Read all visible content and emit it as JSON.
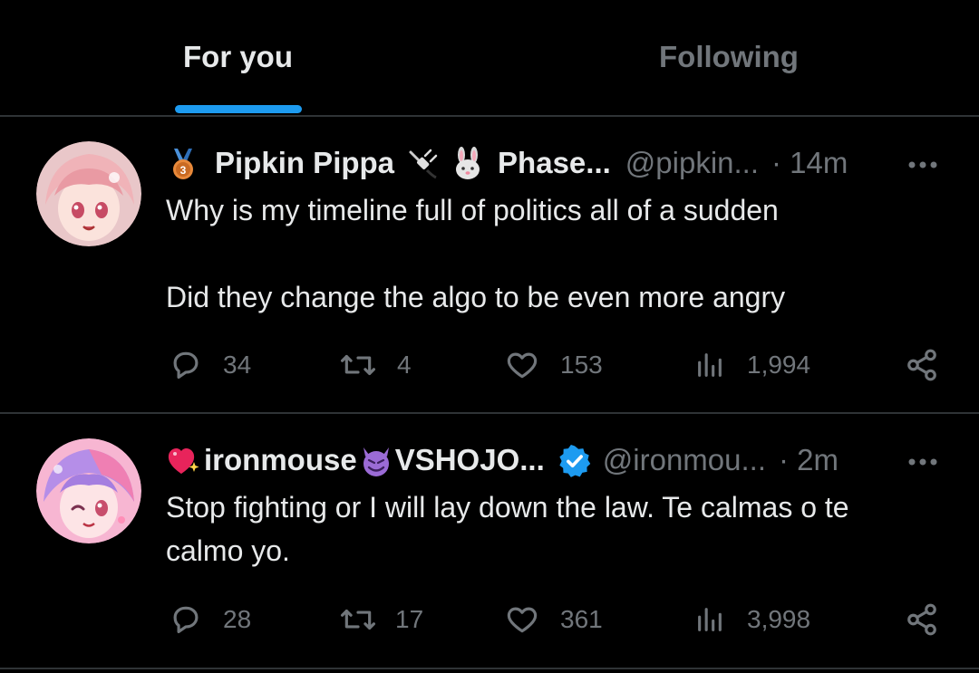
{
  "tabs": [
    {
      "label": "For you",
      "active": true
    },
    {
      "label": "Following",
      "active": false
    }
  ],
  "tweets": [
    {
      "display_name": "Pipkin Pippa",
      "name_suffix": "Phase...",
      "handle": "@pipkin...",
      "time": "· 14m",
      "text": "Why is my timeline full of politics all of a sudden\n\nDid they change the algo to be even more angry",
      "badges": [
        "bronze-medal-icon",
        "plug-icon",
        "rabbit-face-icon"
      ],
      "replies": "34",
      "reposts": "4",
      "likes": "153",
      "views": "1,994"
    },
    {
      "display_name": "ironmouse",
      "name_suffix": "VSHOJO...",
      "handle": "@ironmou...",
      "time": "· 2m",
      "text": "Stop fighting or I will lay down the law. Te calmas o te calmo yo.",
      "badges": [
        "sparkling-heart-icon",
        "smiling-devil-icon",
        "verified-badge-icon"
      ],
      "replies": "28",
      "reposts": "17",
      "likes": "361",
      "views": "3,998"
    }
  ],
  "colors": {
    "background": "#000000",
    "primary_text": "#e7e9ea",
    "secondary_text": "#71767b",
    "accent": "#1d9bf0",
    "divider": "#2f3336"
  }
}
